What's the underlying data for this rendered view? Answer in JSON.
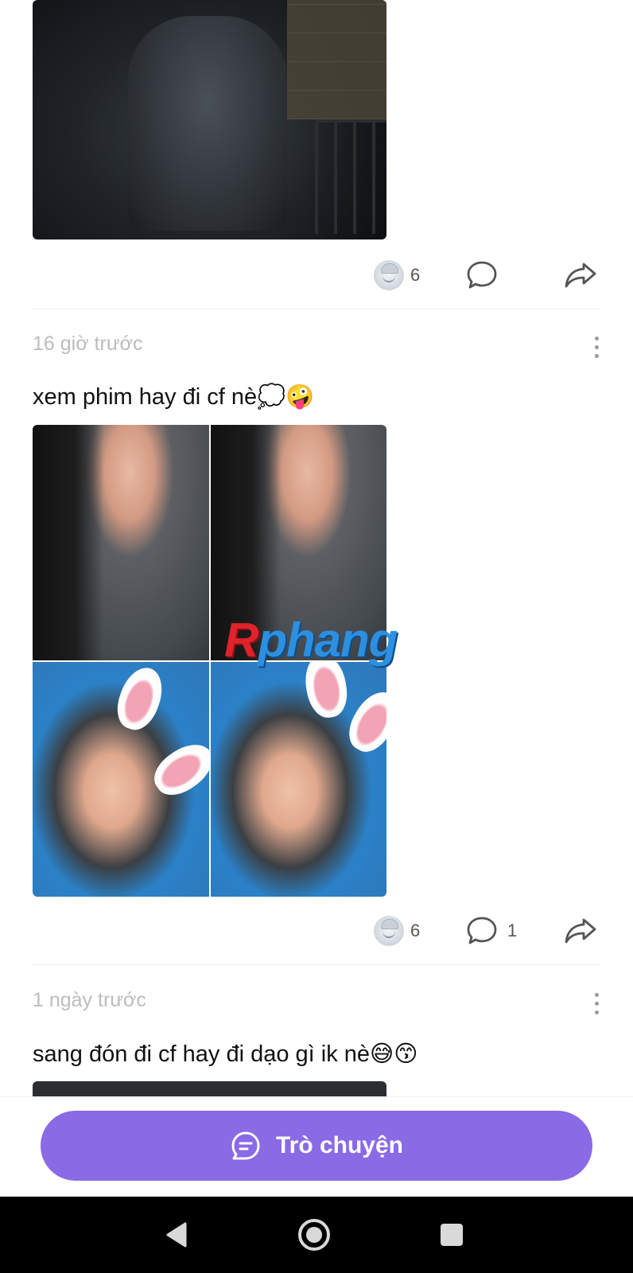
{
  "posts": [
    {
      "reaction_icon": "reaction-sticker-icon",
      "reaction_count": "6",
      "comment_count": ""
    },
    {
      "time": "16 giờ trước",
      "caption": "xem phim hay đi cf nè💭🤪",
      "reaction_count": "6",
      "comment_count": "1"
    },
    {
      "time": "1 ngày trước",
      "caption": "sang đón đi cf hay đi dạo gì ik nè😅😙"
    }
  ],
  "watermark": {
    "first": "R",
    "rest": "phang"
  },
  "chat_button": {
    "label": "Trò chuyện",
    "icon": "chat-bubble-icon"
  },
  "navbar": {
    "back_icon": "back-triangle-icon",
    "home_icon": "home-circle-icon",
    "recents_icon": "recents-square-icon"
  },
  "colors": {
    "accent": "#8a6ae5",
    "muted_text": "#bcbcbc",
    "watermark_blue": "#2d8fe0",
    "watermark_red": "#e0222a"
  }
}
